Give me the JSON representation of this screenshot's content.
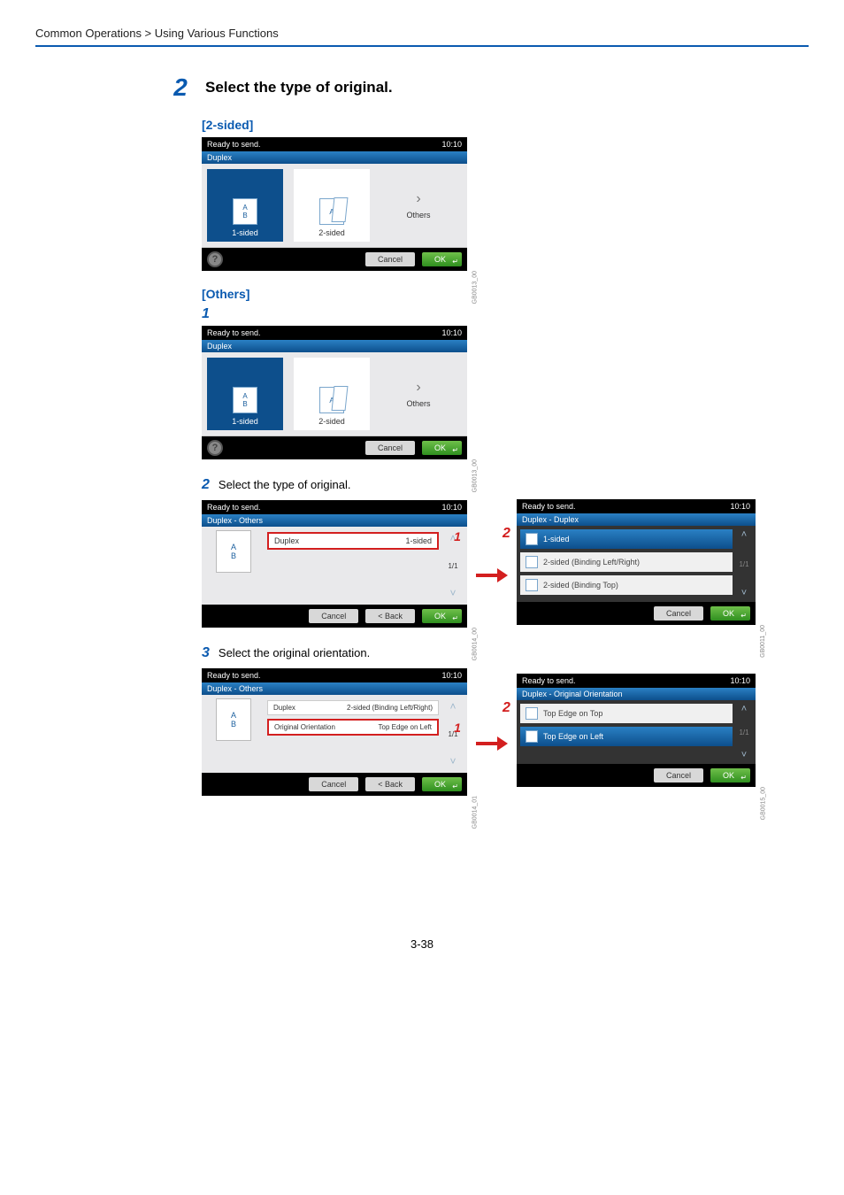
{
  "breadcrumb": "Common Operations > Using Various Functions",
  "step": {
    "number": "2",
    "title": "Select the type of original."
  },
  "section_2sided": {
    "heading": "[2-sided]",
    "panel": {
      "status": "Ready to send.",
      "time": "10:10",
      "tab": "Duplex",
      "opt1": "1-sided",
      "opt2": "2-sided",
      "opt3": "Others",
      "cancel": "Cancel",
      "ok": "OK",
      "side_id": "GB0013_00"
    }
  },
  "section_others": {
    "heading": "[Others]",
    "step1_num": "1",
    "panel1": {
      "status": "Ready to send.",
      "time": "10:10",
      "tab": "Duplex",
      "opt1": "1-sided",
      "opt2": "2-sided",
      "opt3": "Others",
      "cancel": "Cancel",
      "ok": "OK",
      "side_id": "GB0013_00"
    },
    "step2_num": "2",
    "step2_text": "Select the type of original.",
    "panel2_left": {
      "status": "Ready to send.",
      "time": "10:10",
      "tab": "Duplex - Others",
      "row1_label": "Duplex",
      "row1_value": "1-sided",
      "pages": "1/1",
      "cancel": "Cancel",
      "back": "< Back",
      "ok": "OK",
      "side_id": "GB0014_00",
      "badge": "1"
    },
    "panel2_right_num": "2",
    "panel2_right": {
      "status": "Ready to send.",
      "time": "10:10",
      "tab": "Duplex - Duplex",
      "items": [
        "1-sided",
        "2-sided (Binding Left/Right)",
        "2-sided (Binding Top)"
      ],
      "pages": "1/1",
      "cancel": "Cancel",
      "ok": "OK",
      "side_id": "GB0011_00"
    },
    "step3_num": "3",
    "step3_text": "Select the original orientation.",
    "panel3_left": {
      "status": "Ready to send.",
      "time": "10:10",
      "tab": "Duplex - Others",
      "row1_label": "Duplex",
      "row1_value": "2-sided (Binding Left/Right)",
      "row2_label": "Original Orientation",
      "row2_value": "Top Edge on Left",
      "pages": "1/1",
      "cancel": "Cancel",
      "back": "< Back",
      "ok": "OK",
      "side_id": "GB0014_01",
      "badge": "1"
    },
    "panel3_right_num": "2",
    "panel3_right": {
      "status": "Ready to send.",
      "time": "10:10",
      "tab": "Duplex - Original Orientation",
      "items": [
        "Top Edge on Top",
        "Top Edge on Left"
      ],
      "pages": "1/1",
      "cancel": "Cancel",
      "ok": "OK",
      "side_id": "GB0015_00"
    }
  },
  "page_number": "3-38"
}
